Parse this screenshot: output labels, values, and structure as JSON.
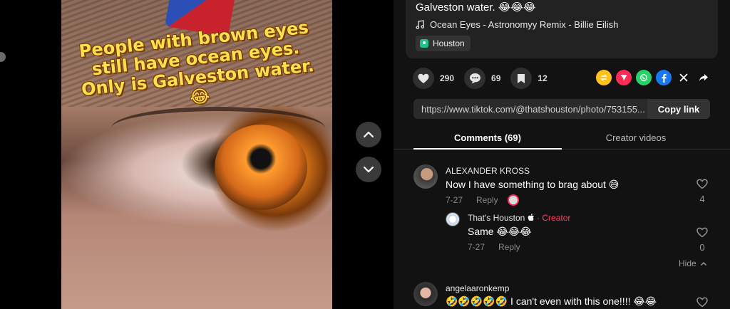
{
  "post": {
    "overlay_caption": "People with brown eyes still have ocean eyes. Only is Galveston water. 😂",
    "description": "Galveston water. 😂😂😂",
    "music": "Ocean Eyes - Astronomyy Remix - Billie Eilish",
    "location": "Houston"
  },
  "actions": {
    "likes": "290",
    "comments": "69",
    "saves": "12",
    "share_colors": [
      "#ffc21a",
      "#fe2c55",
      "#25d366",
      "#1877f2",
      "#000000",
      "#121212"
    ],
    "share_icons": [
      "repost-icon",
      "send-icon",
      "whatsapp-icon",
      "facebook-icon",
      "x-icon",
      "share-arrow-icon"
    ]
  },
  "link": {
    "url": "https://www.tiktok.com/@thatshouston/photo/753155...",
    "copy_label": "Copy link"
  },
  "tabs": {
    "comments": "Comments (69)",
    "creator": "Creator videos"
  },
  "comments": [
    {
      "user": "ALEXANDER KROSS",
      "text": "Now I have something to brag about 😅",
      "date": "7-27",
      "reply_label": "Reply",
      "likes": "4"
    },
    {
      "user": "That's Houston",
      "badge": "· Creator",
      "text": "Same 😂😂😂",
      "date": "7-27",
      "reply_label": "Reply",
      "likes": "0"
    },
    {
      "user": "angelaaronkemp",
      "text": "🤣🤣🤣🤣🤣 I can't even with this one!!!! 😂😂",
      "date": "",
      "reply_label": "",
      "likes": ""
    }
  ],
  "hide_label": "Hide"
}
